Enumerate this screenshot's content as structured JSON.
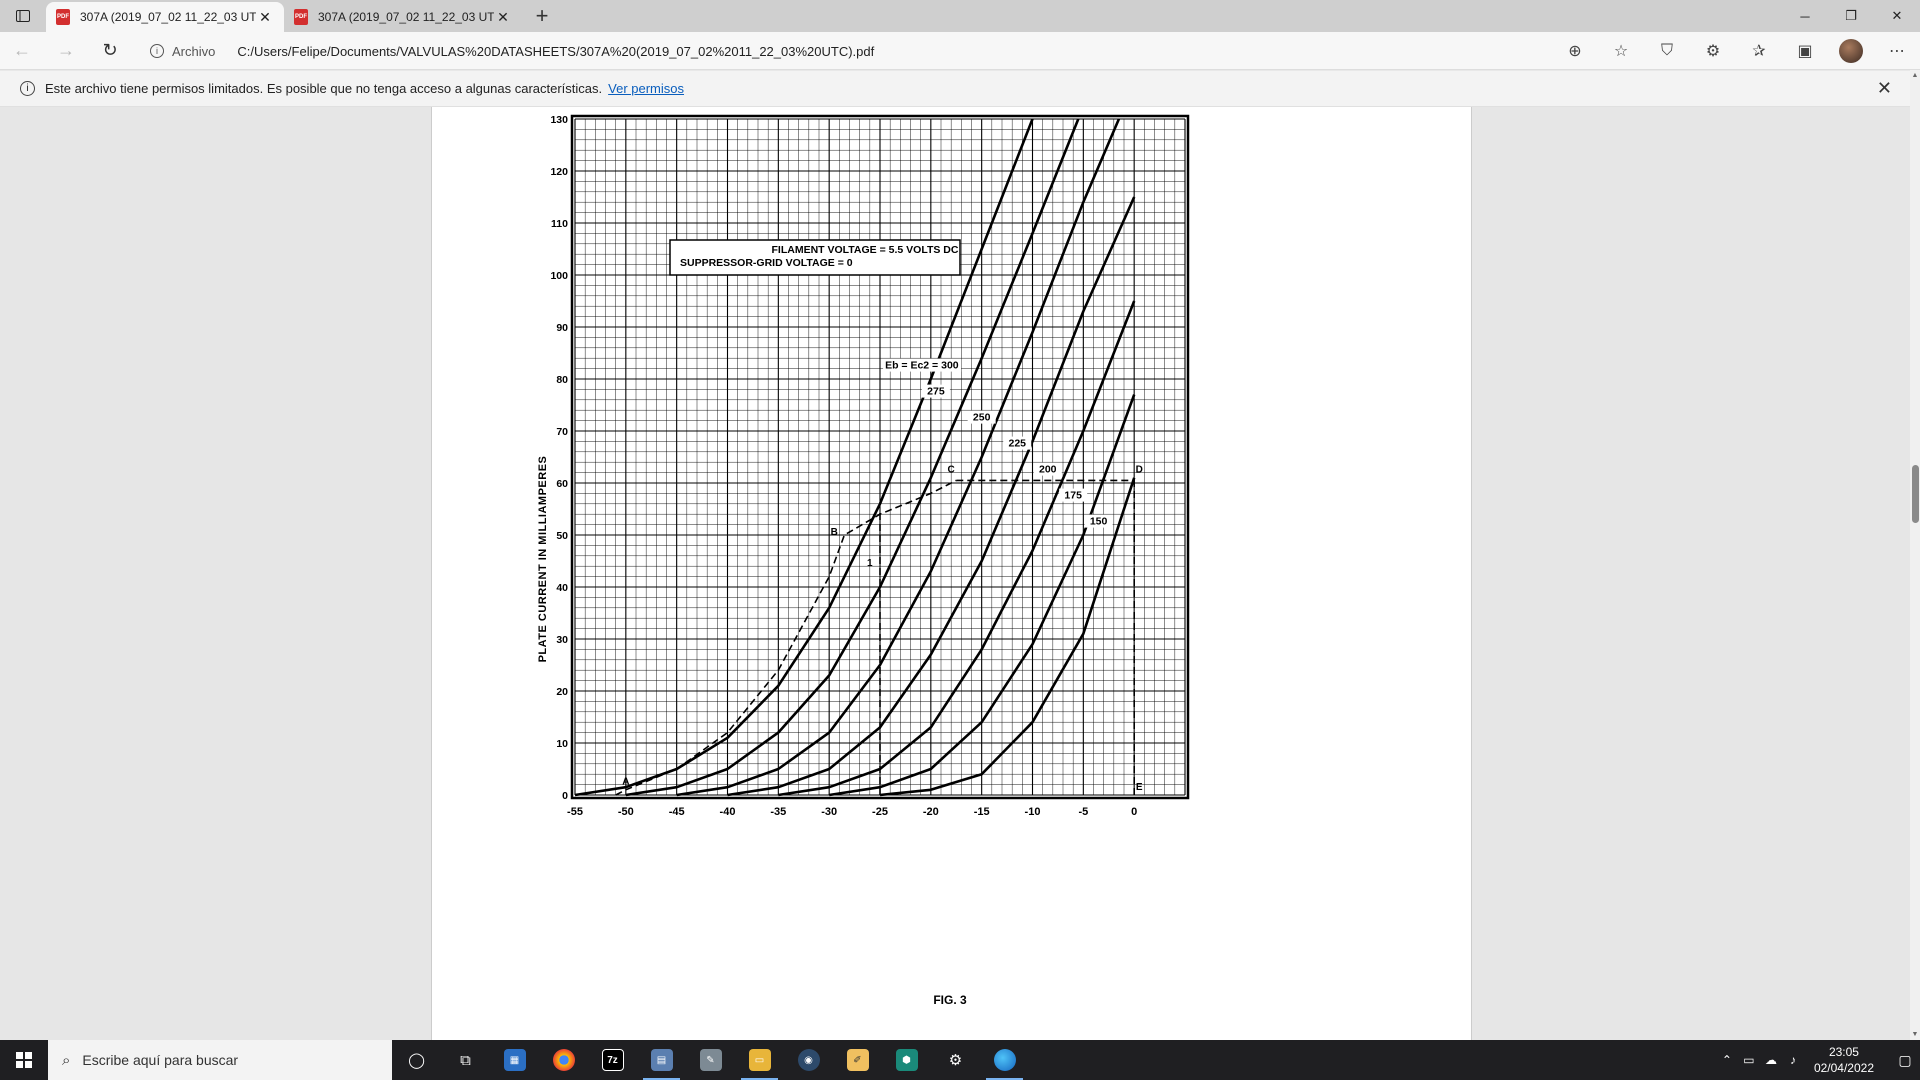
{
  "tabs": [
    {
      "label": "307A (2019_07_02 11_22_03 UTC",
      "active": true
    },
    {
      "label": "307A (2019_07_02 11_22_03 UTC",
      "active": false
    }
  ],
  "toolbar": {
    "site_label": "Archivo",
    "url": "C:/Users/Felipe/Documents/VALVULAS%20DATASHEETS/307A%20(2019_07_02%2011_22_03%20UTC).pdf"
  },
  "infobar": {
    "message": "Este archivo tiene permisos limitados. Es posible que no tenga acceso a algunas características.",
    "link": "Ver permisos"
  },
  "document": {
    "legend_line1": "FILAMENT VOLTAGE = 5.5 VOLTS DC",
    "legend_line2": "SUPPRESSOR-GRID VOLTAGE = 0",
    "ylabel": "PLATE CURRENT IN MILLIAMPERES",
    "caption": "FIG. 3"
  },
  "chart_data": {
    "type": "line",
    "title": "",
    "xlabel": "",
    "ylabel": "PLATE CURRENT IN MILLIAMPERES",
    "xlim": [
      -55,
      5
    ],
    "ylim": [
      0,
      130
    ],
    "x_ticks": [
      -55,
      -50,
      -45,
      -40,
      -35,
      -30,
      -25,
      -20,
      -15,
      -10,
      -5,
      0
    ],
    "x_tick_labels": [
      "-55",
      "-50",
      "-45",
      "-40",
      "-35",
      "-30",
      "-25",
      "-20",
      "-15",
      "-10",
      "-5",
      "0"
    ],
    "y_ticks": [
      0,
      10,
      20,
      30,
      40,
      50,
      60,
      70,
      80,
      90,
      100,
      110,
      120,
      130
    ],
    "grid": true,
    "series": [
      {
        "name": "Eb = Ec2 = 300",
        "label": "Eb = Ec2 = 300",
        "points": [
          [
            -55,
            0
          ],
          [
            -50,
            1.5
          ],
          [
            -45,
            5
          ],
          [
            -40,
            11
          ],
          [
            -35,
            21
          ],
          [
            -30,
            36
          ],
          [
            -25,
            56
          ],
          [
            -20,
            80
          ],
          [
            -15,
            105
          ],
          [
            -10,
            130
          ]
        ]
      },
      {
        "name": "275",
        "label": "275",
        "points": [
          [
            -50,
            0
          ],
          [
            -45,
            1.5
          ],
          [
            -40,
            5
          ],
          [
            -35,
            12
          ],
          [
            -30,
            23
          ],
          [
            -25,
            40
          ],
          [
            -20,
            61
          ],
          [
            -15,
            84
          ],
          [
            -10,
            108
          ],
          [
            -5.5,
            130
          ]
        ]
      },
      {
        "name": "250",
        "label": "250",
        "points": [
          [
            -45,
            0
          ],
          [
            -40,
            1.5
          ],
          [
            -35,
            5
          ],
          [
            -30,
            12
          ],
          [
            -25,
            25
          ],
          [
            -20,
            43
          ],
          [
            -15,
            65
          ],
          [
            -10,
            89
          ],
          [
            -5,
            114
          ],
          [
            -1.5,
            130
          ]
        ]
      },
      {
        "name": "225",
        "label": "225",
        "points": [
          [
            -40,
            0
          ],
          [
            -35,
            1.5
          ],
          [
            -30,
            5
          ],
          [
            -25,
            13
          ],
          [
            -20,
            27
          ],
          [
            -15,
            45
          ],
          [
            -10,
            68
          ],
          [
            -5,
            93
          ],
          [
            0,
            115
          ]
        ]
      },
      {
        "name": "200",
        "label": "200",
        "points": [
          [
            -35,
            0
          ],
          [
            -30,
            1.5
          ],
          [
            -25,
            5
          ],
          [
            -20,
            13
          ],
          [
            -15,
            28
          ],
          [
            -10,
            47
          ],
          [
            -5,
            70
          ],
          [
            0,
            95
          ]
        ]
      },
      {
        "name": "175",
        "label": "175",
        "points": [
          [
            -30,
            0
          ],
          [
            -25,
            1.5
          ],
          [
            -20,
            5
          ],
          [
            -15,
            14
          ],
          [
            -10,
            29
          ],
          [
            -5,
            50
          ],
          [
            0,
            77
          ]
        ]
      },
      {
        "name": "150",
        "label": "150",
        "points": [
          [
            -25,
            0
          ],
          [
            -20,
            1
          ],
          [
            -15,
            4
          ],
          [
            -10,
            14
          ],
          [
            -5,
            31
          ],
          [
            0,
            61
          ]
        ]
      }
    ],
    "dashed_lines": [
      [
        [
          -51,
          0
        ],
        [
          -50,
          1
        ],
        [
          -45,
          5
        ],
        [
          -40,
          12
        ],
        [
          -35,
          24
        ],
        [
          -30,
          42
        ],
        [
          -28.5,
          50
        ],
        [
          -25,
          54
        ],
        [
          -20,
          58
        ],
        [
          -17.5,
          60.5
        ]
      ],
      [
        [
          -17.5,
          60.5
        ],
        [
          0,
          60.5
        ]
      ],
      [
        [
          -25,
          0
        ],
        [
          -25,
          55
        ]
      ],
      [
        [
          0,
          0
        ],
        [
          0,
          61
        ]
      ]
    ],
    "point_labels": [
      {
        "text": "A",
        "x": -50,
        "y": 2
      },
      {
        "text": "B",
        "x": -29.5,
        "y": 50
      },
      {
        "text": "C",
        "x": -18,
        "y": 62
      },
      {
        "text": "D",
        "x": 0.5,
        "y": 62
      },
      {
        "text": "E",
        "x": 0.5,
        "y": 1
      },
      {
        "text": "1",
        "x": -26,
        "y": 44
      }
    ],
    "annotations": [
      "FILAMENT VOLTAGE = 5.5 VOLTS DC",
      "SUPPRESSOR-GRID VOLTAGE = 0"
    ]
  },
  "taskbar": {
    "search_placeholder": "Escribe aquí para buscar",
    "time": "23:05",
    "date": "02/04/2022"
  }
}
